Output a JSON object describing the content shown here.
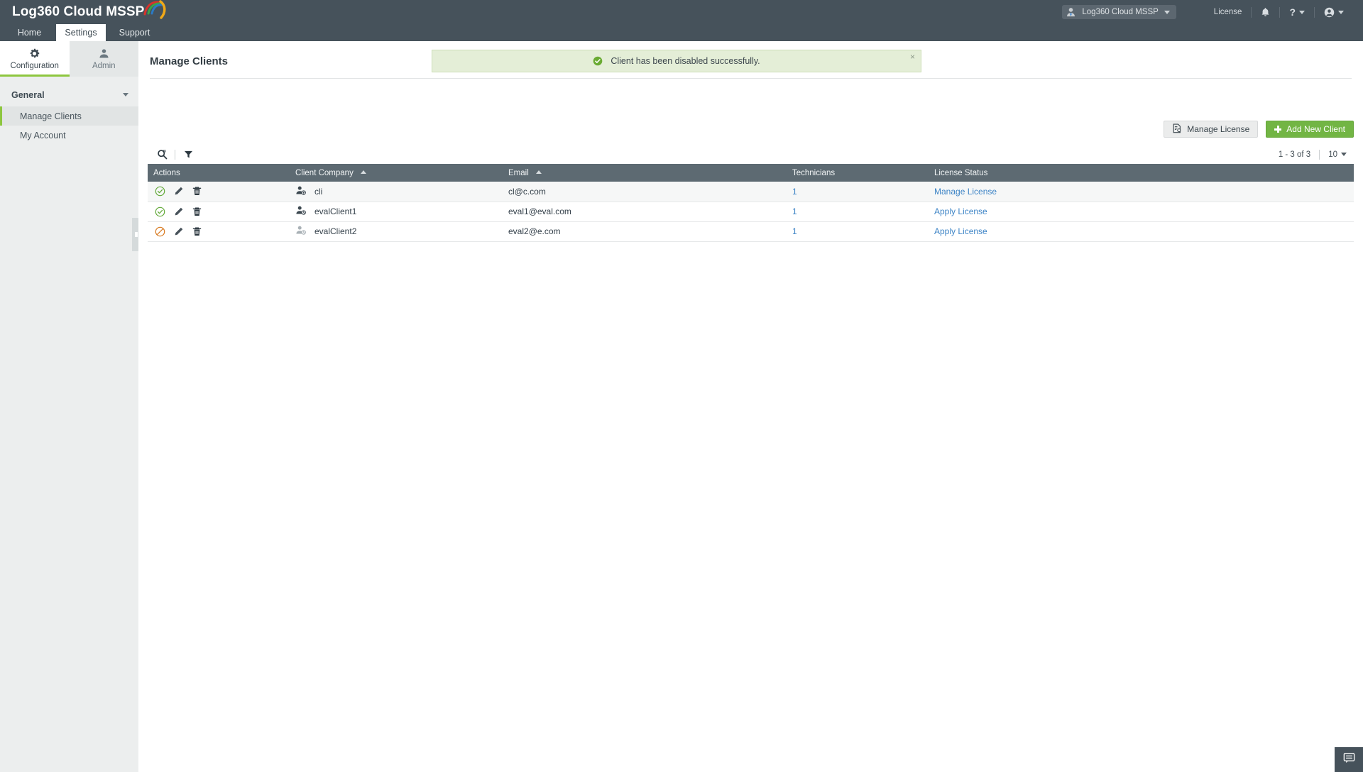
{
  "app": {
    "logo_text": "Log360 Cloud MSSP"
  },
  "topbar": {
    "org_name": "Log360 Cloud MSSP",
    "license_label": "License",
    "help_label": "?",
    "icons": {
      "org_avatar": "user-tie-icon",
      "bell": "notification-bell-icon",
      "help": "help-question-icon",
      "user": "user-account-icon"
    }
  },
  "tabs": [
    {
      "label": "Home",
      "active": false
    },
    {
      "label": "Settings",
      "active": true
    },
    {
      "label": "Support",
      "active": false
    }
  ],
  "sidebar": {
    "tabs": [
      {
        "label": "Configuration",
        "icon": "gear-icon",
        "active": true
      },
      {
        "label": "Admin",
        "icon": "admin-user-icon",
        "active": false
      }
    ],
    "section": {
      "label": "General"
    },
    "items": [
      {
        "label": "Manage Clients",
        "selected": true
      },
      {
        "label": "My Account",
        "selected": false
      }
    ]
  },
  "main": {
    "page_title": "Manage Clients",
    "banner": {
      "text": "Client has been disabled successfully.",
      "close_label": "×",
      "icon": "success-check-icon",
      "bg": "#e4eed7",
      "border": "#cddfb8"
    },
    "buttons": {
      "manage_license": "Manage License",
      "add_new_client": "Add New Client",
      "add_new_client_color": "#72b544"
    },
    "toolbar": {
      "search_icon": "search-icon",
      "filter_icon": "filter-funnel-icon"
    },
    "pager": {
      "count": "1 - 3 of 3",
      "page_size": "10"
    },
    "table": {
      "columns": [
        {
          "label": "Actions",
          "sort": "none"
        },
        {
          "label": "Client Company",
          "sort": "asc"
        },
        {
          "label": "Email",
          "sort": "asc"
        },
        {
          "label": "Technicians",
          "sort": "none"
        },
        {
          "label": "License Status",
          "sort": "none"
        }
      ],
      "rows": [
        {
          "status": "enabled",
          "status_icon": "enable-check-circle-icon",
          "company": "cli",
          "company_icon": "user-verified-icon",
          "email": "cl@c.com",
          "technicians": "1",
          "license_status": "Manage License",
          "disabled": false
        },
        {
          "status": "enabled",
          "status_icon": "enable-check-circle-icon",
          "company": "evalClient1",
          "company_icon": "user-trial-icon",
          "email": "eval1@eval.com",
          "technicians": "1",
          "license_status": "Apply License",
          "disabled": false
        },
        {
          "status": "disabled",
          "status_icon": "disable-block-circle-icon",
          "company": "evalClient2",
          "company_icon": "user-trial-icon",
          "email": "eval2@e.com",
          "technicians": "1",
          "license_status": "Apply License",
          "disabled": true
        }
      ],
      "row_action_icons": [
        "toggle-status-icon",
        "edit-pencil-icon",
        "delete-trash-icon"
      ]
    }
  },
  "chat": {
    "icon": "chat-bubble-icon"
  },
  "colors": {
    "header_bg": "#46525b",
    "accent_green": "#8dc63f",
    "link_blue": "#3d84c6",
    "table_header_bg": "#5d6a72"
  }
}
